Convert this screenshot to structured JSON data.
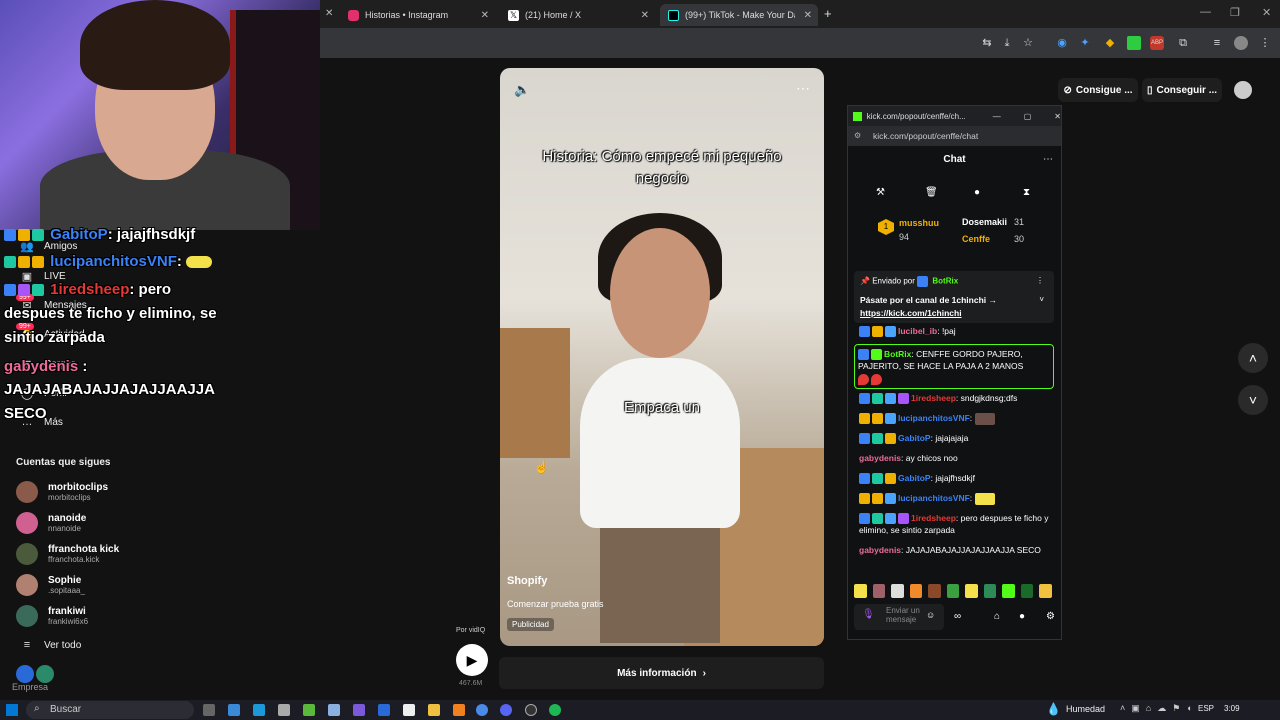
{
  "browser": {
    "tabs": [
      {
        "label": "Historias • Instagram",
        "favicon_color": "#e1306c"
      },
      {
        "label": "(21) Home / X",
        "favicon_color": "#ffffff"
      },
      {
        "label": "(99+) TikTok - Make Your Da",
        "favicon_color": "#ffffff"
      }
    ],
    "new_tab": "+"
  },
  "tiktok": {
    "header_buttons": {
      "get_coins": "Consigue ...",
      "get_app": "Conseguir ..."
    },
    "nav": [
      {
        "label": "Amigos",
        "icon": "users-icon"
      },
      {
        "label": "LIVE",
        "icon": "live-icon"
      },
      {
        "label": "Mensajes",
        "icon": "message-icon",
        "badge": "99+"
      },
      {
        "label": "Actividad",
        "icon": "bell-icon",
        "badge": "99+"
      },
      {
        "label": "Cargar",
        "icon": "upload-icon"
      },
      {
        "label": "Perfil",
        "icon": "profile-icon"
      },
      {
        "label": "Más",
        "icon": "more-icon"
      }
    ],
    "following_title": "Cuentas que sigues",
    "following": [
      {
        "name": "morbitoclips",
        "handle": "morbitoclips",
        "color": "#8a5a4a"
      },
      {
        "name": "nanoide",
        "handle": "nnanoide",
        "color": "#d06090"
      },
      {
        "name": "ffranchota kick",
        "handle": "ffranchota.kick",
        "color": "#4a5a3a"
      },
      {
        "name": "Sophie",
        "handle": ".sopitaaa_",
        "color": "#b08070"
      },
      {
        "name": "frankiwi",
        "handle": "frankiwi6x6",
        "color": "#3a6a5a"
      }
    ],
    "see_all": "Ver todo",
    "company": "Empresa",
    "video": {
      "caption_title": "Historia: Cómo empecé mi pequeño negocio",
      "caption_sub": "Empaca un",
      "advertiser": "Shopify",
      "cta": "Comenzar prueba gratis",
      "ad_label": "Publicidad",
      "more_info": "Más información",
      "by": "Por vidIQ",
      "views": "467.6M"
    }
  },
  "overlay_chat": [
    {
      "user": "GabitoP",
      "text": ": jajajfhsdkjf",
      "color": "#3b82f6"
    },
    {
      "user": "lucipanchitosVNF",
      "text": ":",
      "color": "#3b82f6"
    },
    {
      "user": "1iredsheep",
      "text": ": pero",
      "color": "#e53935"
    },
    {
      "user": "",
      "text": "despues te ficho y elimino, se",
      "color": "#ffffff"
    },
    {
      "user": "",
      "text": "sintio zarpada",
      "color": "#ffffff"
    },
    {
      "user": "gabydenis",
      "text": ":",
      "color": "#ec6b9a"
    },
    {
      "user": "",
      "text": "JAJAJABAJAJJAJAJJAAJJA",
      "color": "#ffffff"
    },
    {
      "user": "",
      "text": "SECO",
      "color": "#ffffff"
    }
  ],
  "kick": {
    "window_title": "kick.com/popout/cenffe/ch...",
    "url": "kick.com/popout/cenffe/chat",
    "chat_title": "Chat",
    "leaderboard": [
      {
        "name": "musshuu",
        "points": "94"
      },
      {
        "name": "Dosemakii",
        "points": "31"
      },
      {
        "name": "Cenffe",
        "points": "30"
      }
    ],
    "pinned": {
      "sent_by": "Enviado por",
      "author": "BotRix",
      "text": "Pásate por el canal de 1chinchi →",
      "link": "https://kick.com/1chinchi"
    },
    "messages": [
      {
        "user": "lucibel_ib",
        "text": ": !paj",
        "color": "#ec6b9a"
      },
      {
        "user": "BotRix",
        "text": ": CENFFE GORDO PAJERO, PAJERITO, SE HACE LA PAJA A 2 MANOS",
        "color": "#53fc18"
      },
      {
        "user": "1iredsheep",
        "text": ": sndgjkdnsg;dfs",
        "color": "#e53935"
      },
      {
        "user": "lucipanchitosVNF",
        "text": ":",
        "color": "#3b82f6"
      },
      {
        "user": "GabitoP",
        "text": ": jajajajaja",
        "color": "#3b82f6"
      },
      {
        "user": "gabydenis",
        "text": ": ay chicos noo",
        "color": "#ec6b9a"
      },
      {
        "user": "GabitoP",
        "text": ": jajajfhsdkjf",
        "color": "#3b82f6"
      },
      {
        "user": "lucipanchitosVNF",
        "text": ":",
        "color": "#3b82f6"
      },
      {
        "user": "1iredsheep",
        "text": ": pero despues te ficho y elimino, se sintio zarpada",
        "color": "#e53935"
      },
      {
        "user": "gabydenis",
        "text": ": JAJAJABAJAJJAJAJJAAJJA SECO",
        "color": "#ec6b9a"
      }
    ],
    "input_placeholder": "Enviar un mensaje"
  },
  "taskbar": {
    "search": "Buscar",
    "weather": "Humedad",
    "lang": "ESP",
    "time": "3:09"
  },
  "colors": {
    "kick_green": "#53fc18",
    "tiktok_bg": "#121212"
  }
}
